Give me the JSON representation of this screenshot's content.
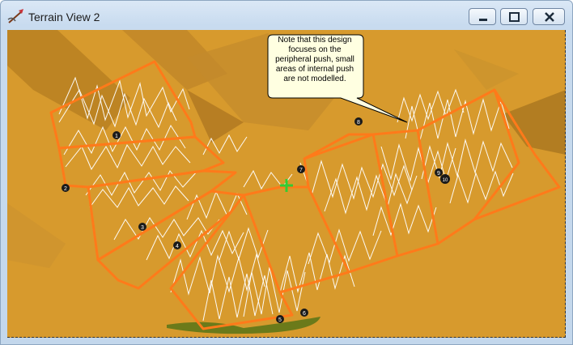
{
  "window": {
    "title": "Terrain View 2",
    "buttons": {
      "minimize_icon": "minimize-icon",
      "maximize_icon": "maximize-icon",
      "close_icon": "close-icon"
    }
  },
  "callout": {
    "text": "Note that this design focuses on the peripheral push, small areas of internal push are not modelled."
  },
  "markers": [
    "1",
    "2",
    "3",
    "4",
    "5",
    "6",
    "7",
    "8",
    "9",
    "10"
  ],
  "colors": {
    "terrain": "#d79a2d",
    "boundary": "#ff7a1a",
    "flow": "#ffffff",
    "marker": "#1a1a1a",
    "cursor": "#33cc33",
    "vegetation": "#6b7a1a"
  }
}
